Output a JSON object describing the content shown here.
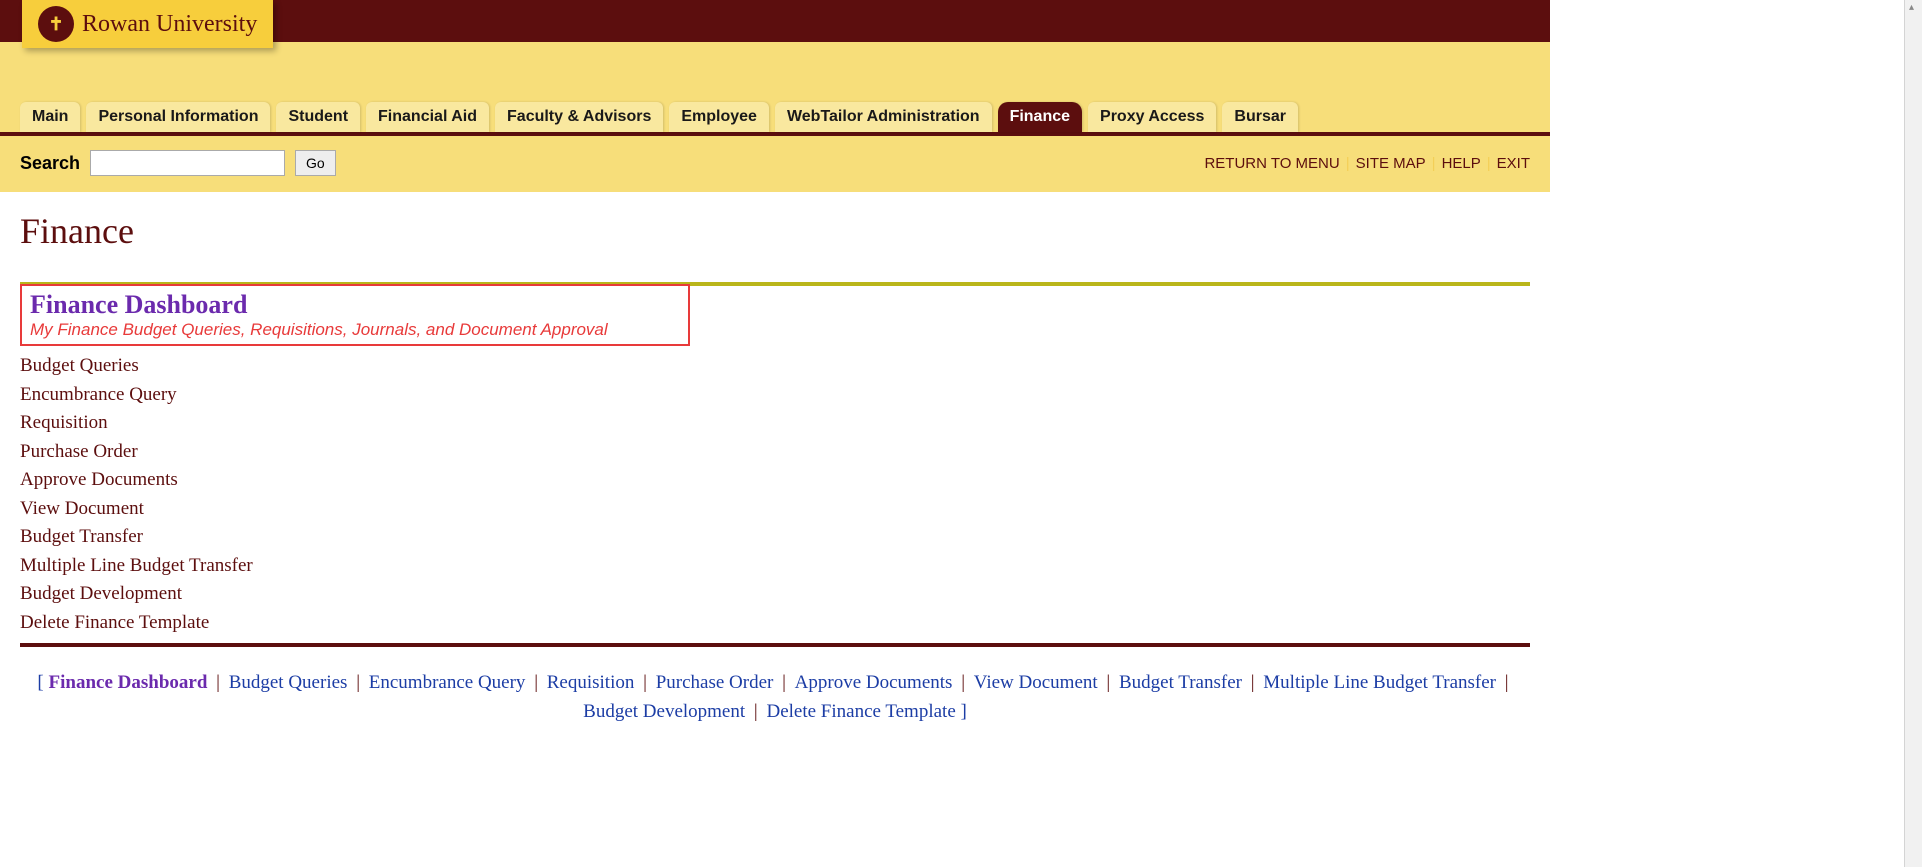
{
  "logo": {
    "text": "Rowan University"
  },
  "tabs": [
    "Main",
    "Personal Information",
    "Student",
    "Financial Aid",
    "Faculty & Advisors",
    "Employee",
    "WebTailor Administration",
    "Finance",
    "Proxy Access",
    "Bursar"
  ],
  "active_tab": "Finance",
  "search": {
    "label": "Search",
    "button": "Go",
    "value": ""
  },
  "top_links": [
    "RETURN TO MENU",
    "SITE MAP",
    "HELP",
    "EXIT"
  ],
  "page_title": "Finance",
  "dashboard": {
    "title": "Finance Dashboard",
    "subtitle": "My Finance Budget Queries, Requisitions, Journals, and Document Approval"
  },
  "menu_items": [
    "Budget Queries",
    "Encumbrance Query",
    "Requisition",
    "Purchase Order",
    "Approve Documents",
    "View Document",
    "Budget Transfer",
    "Multiple Line Budget Transfer",
    "Budget Development",
    "Delete Finance Template"
  ],
  "footer_links": [
    "Finance Dashboard",
    "Budget Queries",
    "Encumbrance Query",
    "Requisition",
    "Purchase Order",
    "Approve Documents",
    "View Document",
    "Budget Transfer",
    "Multiple Line Budget Transfer",
    "Budget Development",
    "Delete Finance Template"
  ]
}
